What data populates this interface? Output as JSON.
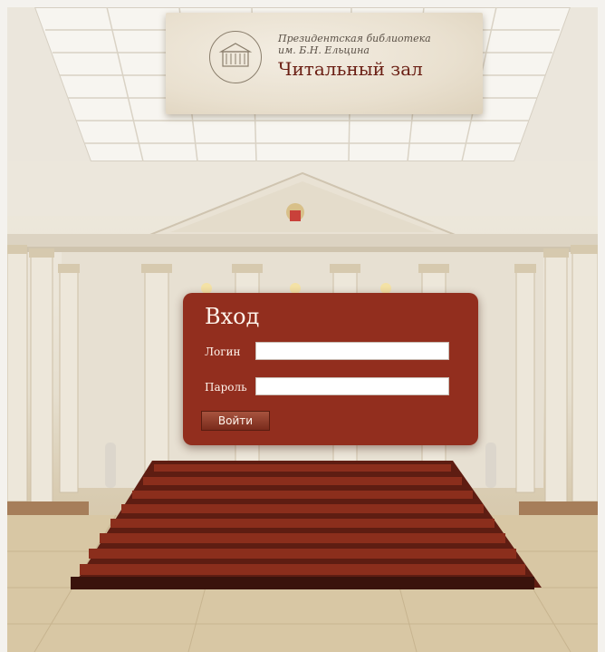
{
  "library_name_line1": "Президентская библиотека",
  "library_name_line2": "им. Б.Н. Ельцина",
  "hall_title": "Читальный зал",
  "login": {
    "title": "Вход",
    "login_label": "Логин",
    "login_value": "",
    "password_label": "Пароль",
    "password_value": "",
    "submit_label": "Войти"
  },
  "colors": {
    "panel": "#922e1e",
    "title_accent": "#6a1e13",
    "seats": "#7a2616"
  },
  "icons": [
    "library-emblem-icon",
    "coat-of-arms-icon"
  ]
}
